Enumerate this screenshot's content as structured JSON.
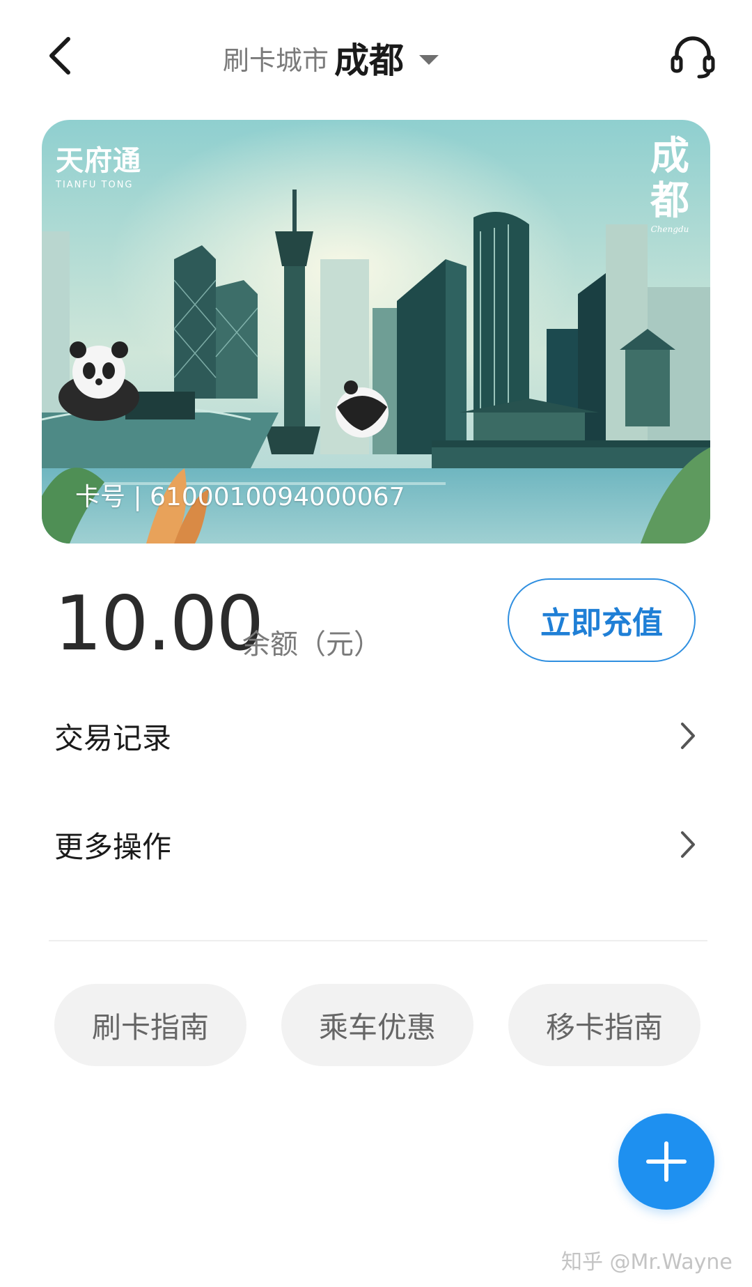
{
  "header": {
    "city_prefix": "刷卡城市",
    "city_name": "成都"
  },
  "card": {
    "brand_cn": "天府通",
    "brand_en": "TIANFU TONG",
    "city_vertical": "成都",
    "city_en": "Chengdu",
    "number_text": "卡号 | 6100010094000067"
  },
  "balance": {
    "value": "10.00",
    "label": "余额（元）"
  },
  "recharge": {
    "label": "立即充值"
  },
  "menu": [
    {
      "label": "交易记录"
    },
    {
      "label": "更多操作"
    }
  ],
  "pills": [
    {
      "label": "刷卡指南"
    },
    {
      "label": "乘车优惠"
    },
    {
      "label": "移卡指南"
    }
  ],
  "watermark": "知乎 @Mr.Wayne",
  "colors": {
    "accent": "#1e90f0",
    "recharge_border": "#2f8fe0",
    "pill_bg": "#f2f2f2"
  },
  "icons": {
    "back": "back-chevron-icon",
    "dropdown": "caret-down-icon",
    "support": "headset-icon",
    "row_arrow": "chevron-right-icon",
    "fab": "plus-icon"
  }
}
